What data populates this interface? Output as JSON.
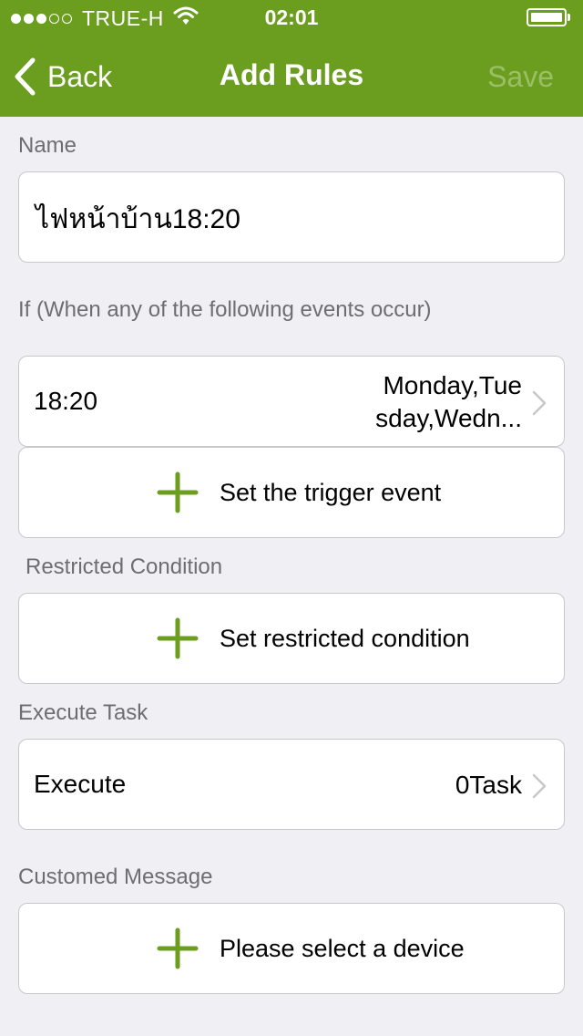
{
  "status_bar": {
    "carrier": "TRUE-H",
    "time": "02:01",
    "signal_full_dots": 3,
    "signal_total_dots": 5,
    "battery_level": 1.0
  },
  "nav": {
    "back_label": "Back",
    "title": "Add Rules",
    "save_label": "Save"
  },
  "colors": {
    "header": "#6b9e1f",
    "accent_plus": "#6b9e1f",
    "save_disabled": "#9bbf66",
    "background": "#efeff4"
  },
  "name_section": {
    "label": "Name",
    "value": "ไฟหน้าบ้าน18:20"
  },
  "if_section": {
    "label": "If (When any of the following events occur)",
    "event": {
      "time": "18:20",
      "days_line1": "Monday,Tue",
      "days_line2": "sday,Wedn..."
    },
    "add_trigger_label": "Set the trigger event"
  },
  "restricted_section": {
    "label": "Restricted Condition",
    "add_label": "Set restricted condition"
  },
  "execute_section": {
    "label": "Execute Task",
    "row_label": "Execute",
    "row_value": "0Task"
  },
  "message_section": {
    "label": "Customed Message",
    "add_label": "Please select a device"
  },
  "icons": {
    "back": "chevron-left-icon",
    "plus": "plus-icon",
    "disclosure": "chevron-right-icon",
    "wifi": "wifi-icon",
    "battery": "battery-icon"
  }
}
